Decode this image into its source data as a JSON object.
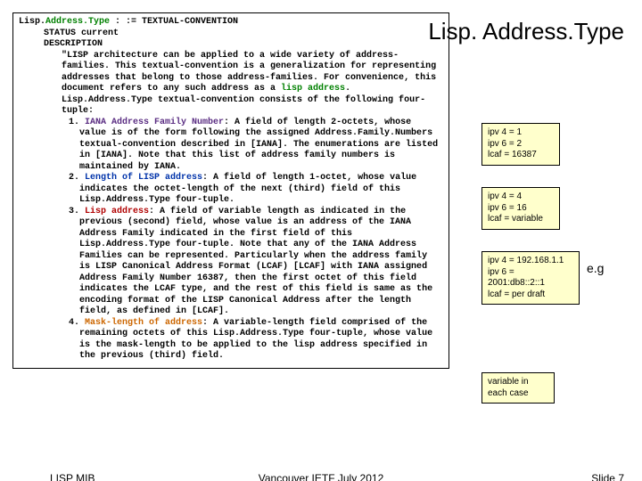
{
  "title": "Lisp. Address.Type",
  "code": {
    "l1a": "Lisp.",
    "l1b": "Address.Type",
    "l1c": " : := TEXTUAL-CONVENTION",
    "l2": "STATUS current",
    "l3": "DESCRIPTION",
    "l4": "\"LISP architecture can be applied to a wide variety of address-families. This textual-convention is a generalization for representing addresses that belong to those address-families. For convenience, this document refers to any such address as a ",
    "l4h": "lisp address",
    "l4b": ". Lisp.Address.Type textual-convention consists of the following four-tuple:",
    "i1n": "1. ",
    "i1h": "IANA Address Family Number",
    "i1b": ": A field of length 2-octets, whose value is of the form following the assigned Address.Family.Numbers textual-convention described in [IANA]. The enumerations are listed in [IANA].  Note that this list of address family numbers is maintained by IANA.",
    "i2n": "2. ",
    "i2h": "Length of LISP address",
    "i2b": ": A field of length 1-octet, whose value indicates the octet-length of the next (third) field of this Lisp.Address.Type four-tuple.",
    "i3n": "3. ",
    "i3h": "Lisp address",
    "i3b": ": A field of variable length as indicated in the previous (second) field, whose value is an address of the IANA Address Family indicated in the first field of this Lisp.Address.Type four-tuple.  Note that any of the IANA Address Families can be represented. Particularly when the address family is LISP Canonical Address Format (LCAF) [LCAF] with IANA assigned Address Family Number 16387, then the first octet of this field indicates the LCAF type, and the rest of this field is same as the encoding format of the LISP Canonical Address after the length field, as defined in [LCAF].",
    "i4n": "4. ",
    "i4h": "Mask-length of address",
    "i4b": ": A variable-length field comprised of the remaining octets of this Lisp.Address.Type four-tuple, whose value is the mask-length to be applied to the lisp address specified in the previous (third) field."
  },
  "box1": {
    "l1": "ipv 4 = 1",
    "l2": "ipv 6 = 2",
    "l3": "lcaf = 16387"
  },
  "box2": {
    "l1": "ipv 4 = 4",
    "l2": "ipv 6 = 16",
    "l3": "lcaf = variable"
  },
  "box3": {
    "l1": "ipv 4 = 192.168.1.1",
    "l2": "ipv 6 = 2001:db8::2::1",
    "l3": "lcaf = per draft"
  },
  "box4": {
    "l1": "variable in",
    "l2": "each case"
  },
  "eg": "e.g",
  "footer": {
    "left": "LISP MIB",
    "center": "Vancouver IETF July 2012",
    "right": "Slide 7"
  }
}
